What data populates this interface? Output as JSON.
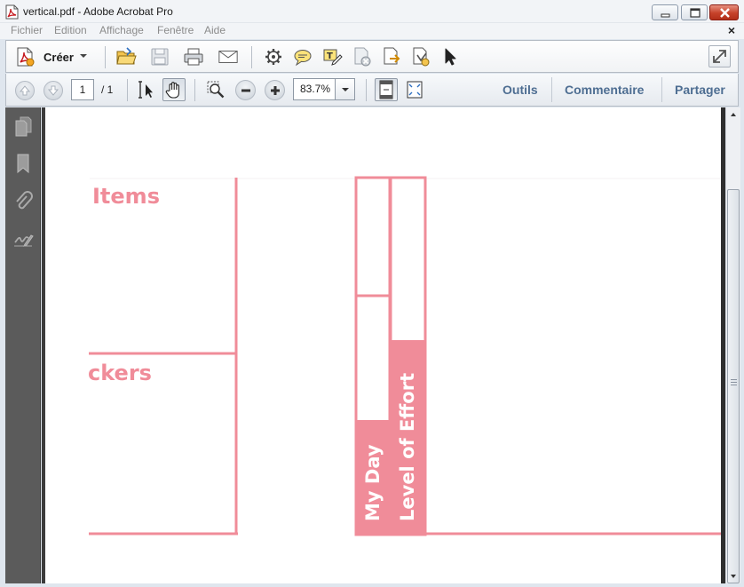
{
  "window": {
    "title": "vertical.pdf - Adobe Acrobat Pro"
  },
  "menu": {
    "items": [
      "Fichier",
      "Edition",
      "Affichage",
      "Fenêtre",
      "Aide"
    ],
    "close_glyph": "×"
  },
  "toolbar": {
    "create_label": "Créer"
  },
  "navigation": {
    "current_page": "1",
    "total_pages": "/ 1",
    "zoom": "83.7%"
  },
  "task_panes": {
    "tools": "Outils",
    "comment": "Commentaire",
    "share": "Partager"
  },
  "document": {
    "heading_items": "Items",
    "heading_stickers": "ckers",
    "label_my_day": "My Day",
    "label_level_of_effort": "Level of Effort"
  },
  "colors": {
    "accent_pink": "#f08c99",
    "link_blue": "#4e6e92"
  },
  "icons": {
    "left_panel": [
      "pages-icon",
      "bookmark-icon",
      "attachment-icon",
      "signature-icon"
    ],
    "toolbar": [
      "open-folder-icon",
      "save-icon",
      "print-icon",
      "email-icon",
      "settings-icon",
      "comment-icon",
      "text-edit-icon",
      "delete-page-icon",
      "export-icon",
      "sign-icon",
      "select-icon"
    ]
  }
}
